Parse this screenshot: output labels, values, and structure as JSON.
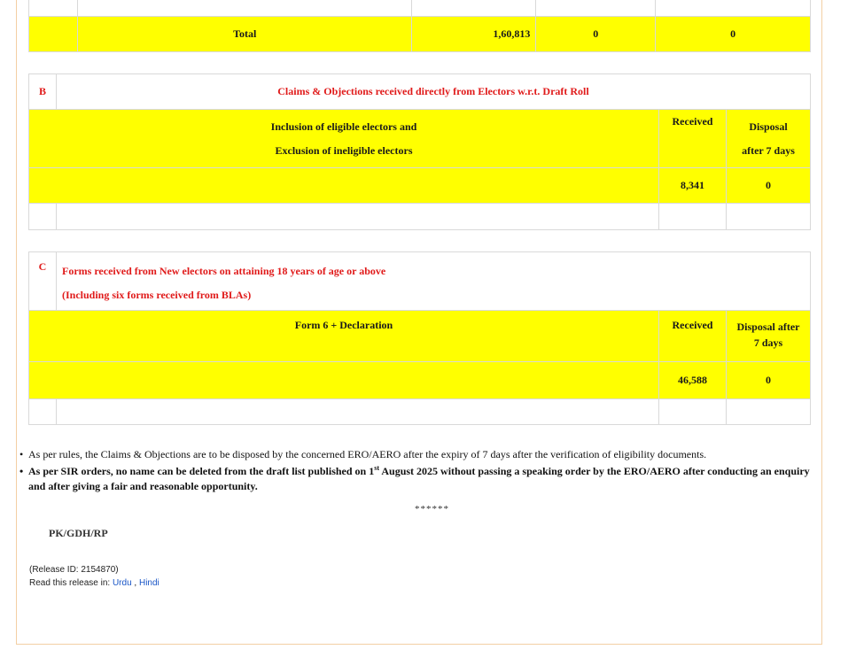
{
  "section_a": {
    "total_label": "Total",
    "total_value": "1,60,813",
    "col3_value": "0",
    "col4_value": "0"
  },
  "section_b": {
    "letter": "B",
    "title": "Claims & Objections received directly from Electors w.r.t. Draft Roll",
    "desc_line1": "Inclusion of eligible electors and",
    "desc_line2": "Exclusion of ineligible electors",
    "received_header": "Received",
    "disposal_header_line1": "Disposal",
    "disposal_header_line2": "after 7 days",
    "received_value": "8,341",
    "disposal_value": "0"
  },
  "section_c": {
    "letter": "C",
    "title_line1": "Forms received from New electors on attaining 18 years of age or above",
    "title_line2": "(Including six forms received from BLAs)",
    "form_label": "Form 6 + Declaration",
    "received_header": "Received",
    "disposal_header_line1": "Disposal after",
    "disposal_header_line2": "7 days",
    "received_value": "46,588",
    "disposal_value": "0"
  },
  "notes": {
    "note1": "As per rules, the Claims & Objections are to be disposed by the concerned ERO/AERO after the expiry of 7 days after the verification of eligibility documents.",
    "note2_pre": "As per SIR orders, no name can be deleted from the draft list published on 1",
    "note2_sup": "st",
    "note2_post": " August 2025 without passing a speaking order by the ERO/AERO after conducting an enquiry and after giving a fair and reasonable opportunity."
  },
  "separator": "******",
  "signature": "PK/GDH/RP",
  "release": {
    "id_text": "(Release ID: 2154870)",
    "read_in": "Read this release in:",
    "lang1": "Urdu",
    "sep": ",",
    "lang2": "Hindi"
  },
  "colors": {
    "highlight": "#ffff00",
    "title_red": "#e01a1a",
    "link": "#1a56c7"
  }
}
